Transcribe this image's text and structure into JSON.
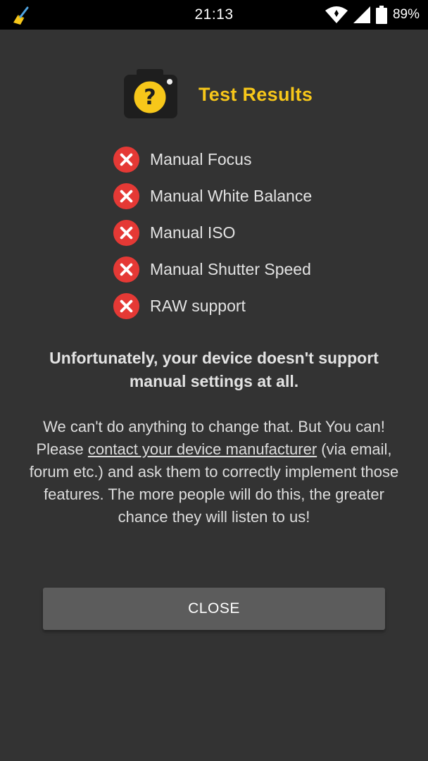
{
  "status_bar": {
    "time": "21:13",
    "battery": "89%",
    "icons": {
      "app": "broom-icon",
      "wifi": "wifi-icon",
      "signal": "signal-icon",
      "battery": "battery-icon"
    }
  },
  "header": {
    "title": "Test Results",
    "icon": "camera-question-icon"
  },
  "features": [
    {
      "label": "Manual Focus",
      "status_icon": "x-circle-icon"
    },
    {
      "label": "Manual White Balance",
      "status_icon": "x-circle-icon"
    },
    {
      "label": "Manual ISO",
      "status_icon": "x-circle-icon"
    },
    {
      "label": "Manual Shutter Speed",
      "status_icon": "x-circle-icon"
    },
    {
      "label": "RAW support",
      "status_icon": "x-circle-icon"
    }
  ],
  "warning": "Unfortunately, your device doesn't support manual settings at all.",
  "message": {
    "before_link": "We can't do anything to change that. But You can! Please ",
    "link": "contact your device manufacturer",
    "after_link": " (via email, forum etc.) and ask them to correctly implement those features. The more people will do this, the greater chance they will listen to us!"
  },
  "close_button": "CLOSE",
  "colors": {
    "background": "#333333",
    "accent": "#f7c71a",
    "error": "#e53935",
    "button": "#5c5c5c"
  }
}
